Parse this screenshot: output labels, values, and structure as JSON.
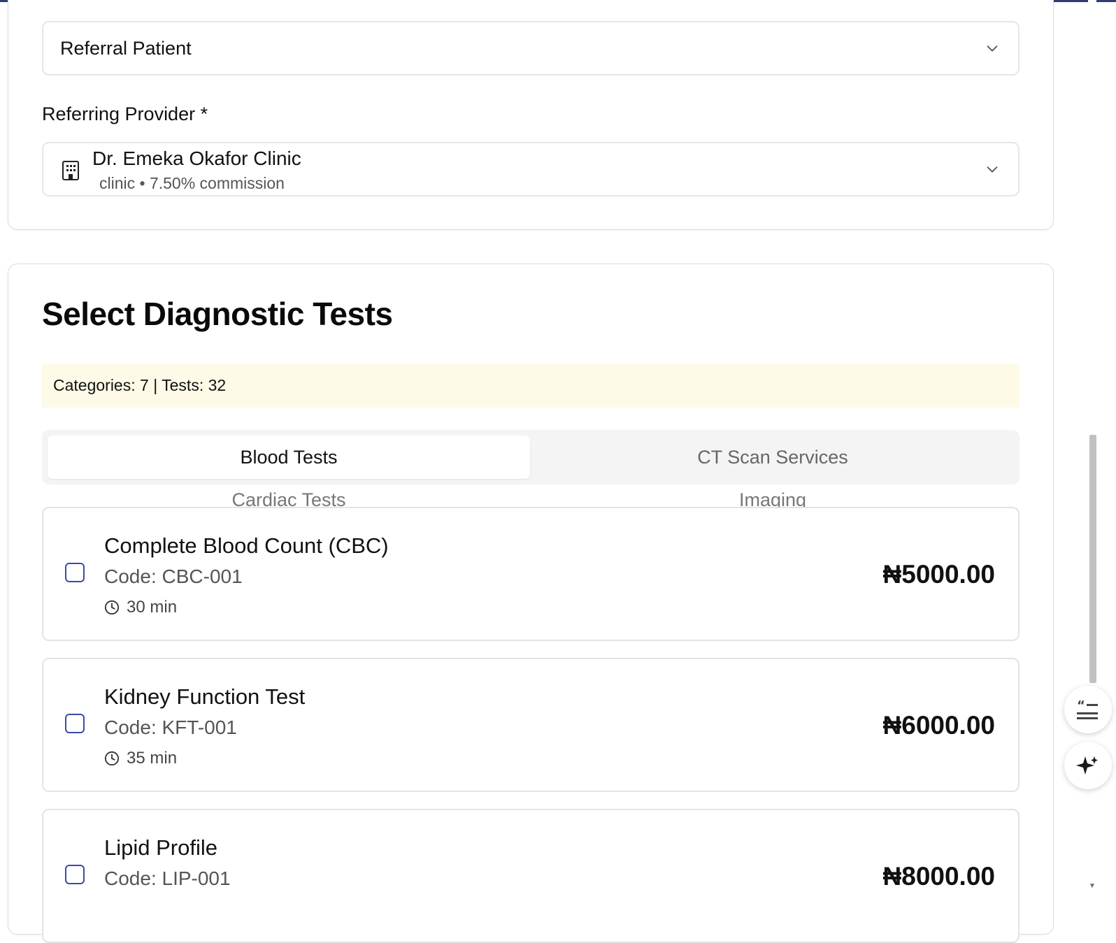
{
  "patient_type": {
    "selected": "Referral Patient",
    "icon": "chevron-down-icon"
  },
  "referring_provider": {
    "label": "Referring Provider *",
    "name": "Dr. Emeka Okafor Clinic",
    "meta": "clinic • 7.50% commission",
    "icon": "building-icon"
  },
  "diagnostics": {
    "title": "Select Diagnostic Tests",
    "summary": "Categories: 7 | Tests: 32",
    "tabs": [
      {
        "label": "Blood Tests",
        "active": true
      },
      {
        "label": "CT Scan Services",
        "active": false
      },
      {
        "label": "Cardiac Tests",
        "active": false
      },
      {
        "label": "Imaging",
        "active": false
      }
    ],
    "tests": [
      {
        "name": "Complete Blood Count (CBC)",
        "code": "Code: CBC-001",
        "duration": "30 min",
        "price": "₦5000.00",
        "checked": false
      },
      {
        "name": "Kidney Function Test",
        "code": "Code: KFT-001",
        "duration": "35 min",
        "price": "₦6000.00",
        "checked": false
      },
      {
        "name": "Lipid Profile",
        "code": "Code: LIP-001",
        "duration": "",
        "price": "₦8000.00",
        "checked": false
      }
    ]
  },
  "colors": {
    "accent": "#3b4aa8",
    "summary_bg": "#fdfbe7",
    "top_rule": "#2f3c78"
  }
}
